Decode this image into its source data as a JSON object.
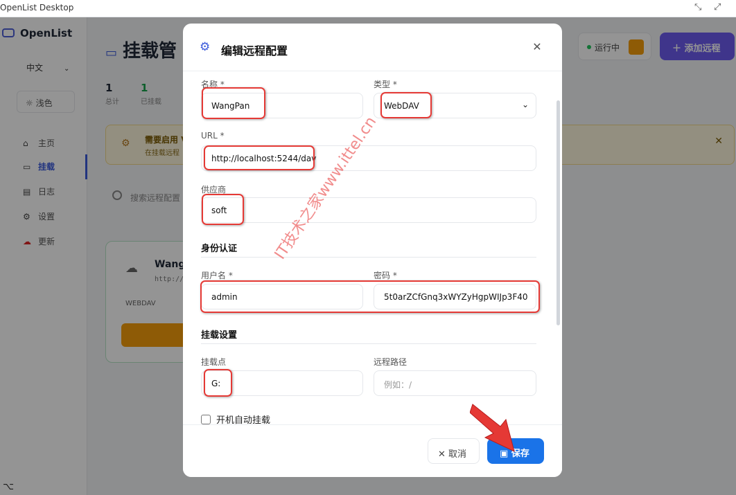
{
  "window": {
    "title": "OpenList Desktop",
    "minimize_glyph": "⤡",
    "maximize_glyph": "⤢"
  },
  "sidebar": {
    "brand": "OpenList",
    "language": "中文",
    "theme": "浅色",
    "items": [
      {
        "label": "主页",
        "icon": "home-icon"
      },
      {
        "label": "挂载",
        "icon": "drive-icon"
      },
      {
        "label": "日志",
        "icon": "file-text-icon"
      },
      {
        "label": "设置",
        "icon": "gear-icon"
      },
      {
        "label": "更新",
        "icon": "cloud-update-icon"
      }
    ]
  },
  "main": {
    "title": "挂载管",
    "stats": [
      {
        "value": "1",
        "label": "总计"
      },
      {
        "value": "1",
        "label": "已挂载"
      }
    ],
    "status_text": "运行中",
    "add_button": "添加远程",
    "banner_title": "需要启用 V",
    "banner_sub": "在挂载远程",
    "search_placeholder": "搜索远程配置",
    "card": {
      "name": "WangP",
      "url": "http://",
      "type": "WEBDAV"
    }
  },
  "modal": {
    "title": "编辑远程配置",
    "labels": {
      "name": "名称 *",
      "type": "类型 *",
      "url": "URL *",
      "vendor": "供应商",
      "auth_section": "身份认证",
      "username": "用户名 *",
      "password": "密码 *",
      "mount_section": "挂载设置",
      "mount_point": "挂载点",
      "remote_path": "远程路径",
      "auto_mount": "开机自动挂载"
    },
    "values": {
      "name": "WangPan",
      "type": "WebDAV",
      "url": "http://localhost:5244/dav",
      "vendor": "soft",
      "username": "admin",
      "password": "5t0arZCfGnq3xWYZyHgpWIJp3F40",
      "mount_point": "G:"
    },
    "placeholders": {
      "remote_path": "例如：/"
    },
    "cancel": "取消",
    "save": "保存"
  },
  "watermark": "IT技术之家www.ittel.cn",
  "colors": {
    "accent": "#1a73e8",
    "highlight": "#e53935",
    "brand": "#4f5fd8"
  }
}
